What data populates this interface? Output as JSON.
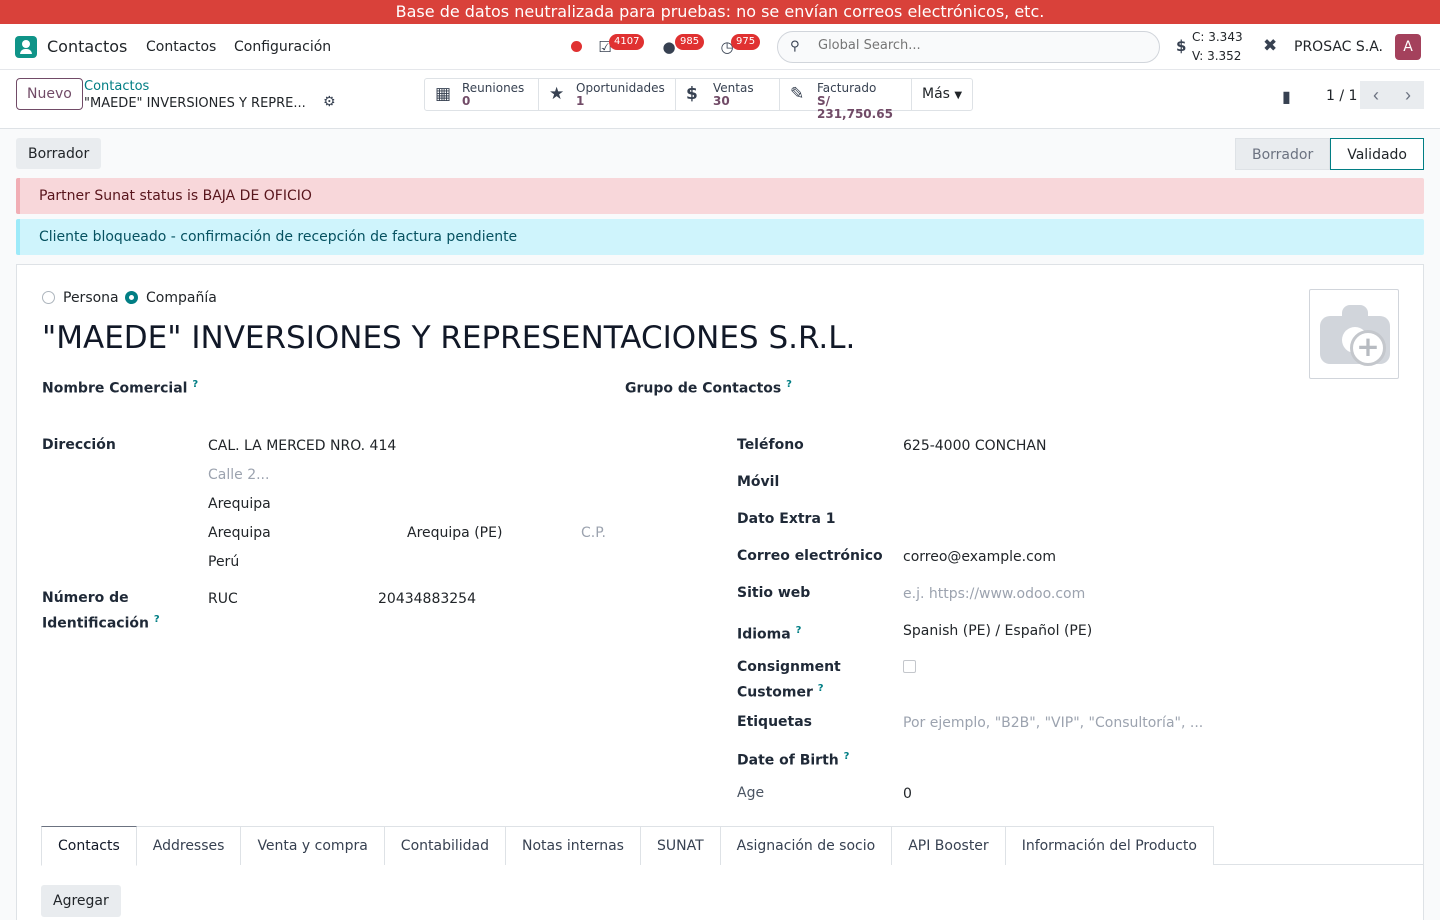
{
  "banner": "Base de datos neutralizada para pruebas: no se envían correos electrónicos, etc.",
  "navbar": {
    "app_name": "Contactos",
    "menu": [
      "Contactos",
      "Configuración"
    ],
    "badges": {
      "activities": "4107",
      "messages": "985",
      "timers": "975"
    },
    "search_placeholder": "Global Search...",
    "rates": {
      "buy": "C: 3.343",
      "sell": "V: 3.352"
    },
    "company": "PROSAC S.A.",
    "avatar_letter": "A",
    "colors": {
      "accent": "#714b67",
      "teal": "#017e84",
      "banner": "#d9413a"
    }
  },
  "control": {
    "new_label": "Nuevo",
    "breadcrumb_parent": "Contactos",
    "breadcrumb_current": "\"MAEDE\" INVERSIONES Y REPRE...",
    "smart_buttons": [
      {
        "label": "Reuniones",
        "value": "0",
        "icon": "calendar-icon"
      },
      {
        "label": "Oportunidades",
        "value": "1",
        "icon": "star-icon"
      },
      {
        "label": "Ventas",
        "value": "30",
        "icon": "dollar-icon"
      },
      {
        "label": "Facturado",
        "value": "S/ 231,750.65",
        "icon": "invoice-edit-icon"
      }
    ],
    "more_label": "Más",
    "pager": "1 / 1"
  },
  "status": {
    "action_label": "Borrador",
    "stages": [
      "Borrador",
      "Validado"
    ],
    "active_stage": "Validado"
  },
  "alerts": {
    "danger": "Partner Sunat status is BAJA DE OFICIO",
    "info": "Cliente bloqueado - confirmación de recepción de factura pendiente"
  },
  "form": {
    "type_person": "Persona",
    "type_company": "Compañía",
    "selected_type": "Compañía",
    "name": "\"MAEDE\" INVERSIONES Y REPRESENTACIONES S.R.L.",
    "labels": {
      "commercial_name": "Nombre Comercial",
      "contact_group": "Grupo de Contactos",
      "address": "Dirección",
      "id_number_1": "Número de",
      "id_number_2": "Identificación",
      "phone": "Teléfono",
      "mobile": "Móvil",
      "extra": "Dato Extra 1",
      "email": "Correo electrónico",
      "website": "Sitio web",
      "language": "Idioma",
      "consignment_1": "Consignment",
      "consignment_2": "Customer",
      "tags": "Etiquetas",
      "birth": "Date of Birth",
      "age": "Age"
    },
    "address": {
      "street": "CAL. LA MERCED NRO. 414",
      "street2_placeholder": "Calle 2...",
      "district": "Arequipa",
      "city": "Arequipa",
      "state": "Arequipa (PE)",
      "zip_placeholder": "C.P.",
      "country": "Perú"
    },
    "id_type": "RUC",
    "id_value": "20434883254",
    "phone": "625-4000 CONCHAN",
    "email": "correo@example.com",
    "website_placeholder": "e.j. https://www.odoo.com",
    "language": "Spanish (PE) / Español (PE)",
    "tags_placeholder": "Por ejemplo, \"B2B\", \"VIP\", \"Consultoría\", ...",
    "age": "0"
  },
  "tabs": [
    "Contacts",
    "Addresses",
    "Venta y compra",
    "Contabilidad",
    "Notas internas",
    "SUNAT",
    "Asignación de socio",
    "API Booster",
    "Información del Producto"
  ],
  "active_tab": "Contacts",
  "add_label": "Agregar"
}
